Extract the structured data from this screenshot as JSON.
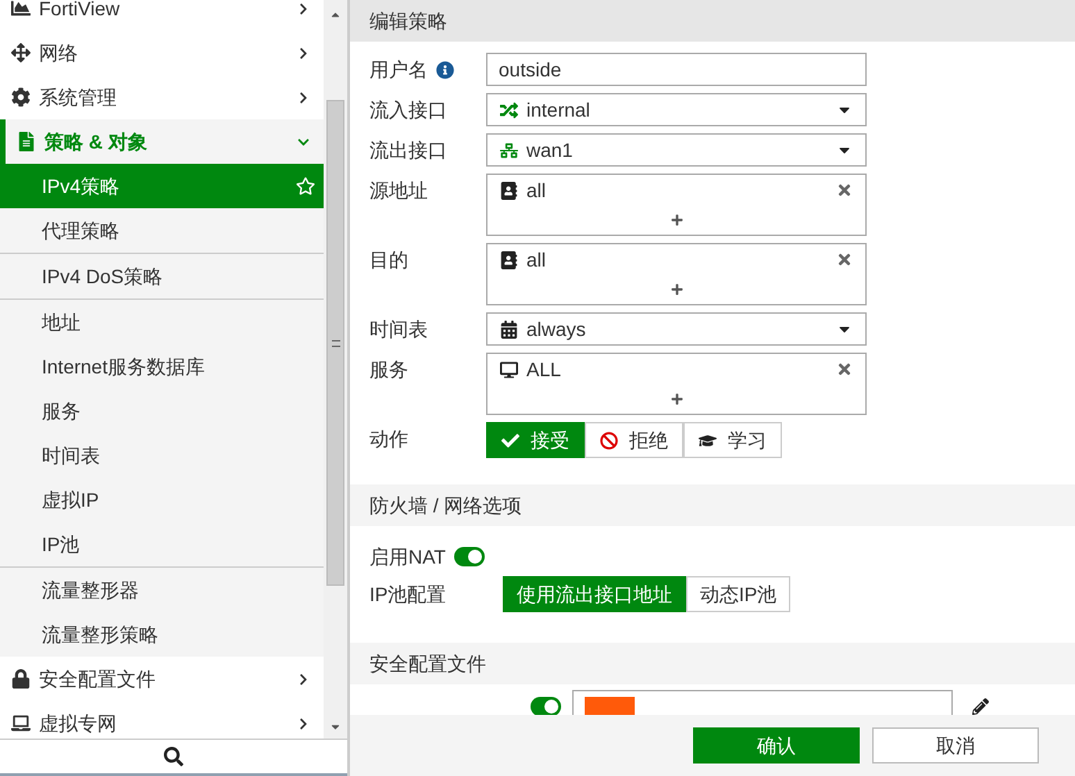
{
  "sidebar": {
    "items": [
      {
        "label": "FortiView",
        "expanded": false
      },
      {
        "label": "网络",
        "expanded": false
      },
      {
        "label": "系统管理",
        "expanded": false
      },
      {
        "label": "策略 & 对象",
        "expanded": true,
        "groups": [
          [
            {
              "label": "IPv4策略",
              "selected": true
            },
            {
              "label": "代理策略",
              "selected": false
            }
          ],
          [
            {
              "label": "IPv4 DoS策略",
              "selected": false
            }
          ],
          [
            {
              "label": "地址",
              "selected": false
            },
            {
              "label": "Internet服务数据库",
              "selected": false
            },
            {
              "label": "服务",
              "selected": false
            },
            {
              "label": "时间表",
              "selected": false
            },
            {
              "label": "虚拟IP",
              "selected": false
            },
            {
              "label": "IP池",
              "selected": false
            }
          ],
          [
            {
              "label": "流量整形器",
              "selected": false
            },
            {
              "label": "流量整形策略",
              "selected": false
            }
          ]
        ]
      },
      {
        "label": "安全配置文件",
        "expanded": false
      },
      {
        "label": "虚拟专网",
        "expanded": false
      }
    ]
  },
  "form": {
    "title": "编辑策略",
    "fields": [
      {
        "kind": "text",
        "label": "用户名",
        "info": true,
        "value": "outside"
      },
      {
        "kind": "select",
        "label": "流入接口",
        "value": "internal"
      },
      {
        "kind": "select",
        "label": "流出接口",
        "value": "wan1"
      },
      {
        "kind": "multi",
        "label": "源地址",
        "entries": [
          "all"
        ]
      },
      {
        "kind": "multi",
        "label": "目的",
        "entries": [
          "all"
        ]
      },
      {
        "kind": "select",
        "label": "时间表",
        "value": "always"
      },
      {
        "kind": "multi",
        "label": "服务",
        "entries": [
          "ALL"
        ]
      },
      {
        "kind": "choice",
        "label": "动作",
        "options": [
          {
            "label": "接受",
            "selected": true
          },
          {
            "label": "拒绝",
            "selected": false
          },
          {
            "label": "学习",
            "selected": false
          }
        ]
      }
    ]
  },
  "firewall": {
    "title": "防火墙 / 网络选项",
    "nat": {
      "label": "启用NAT",
      "on": true
    },
    "ip_pool": {
      "label": "IP池配置",
      "options": [
        {
          "label": "使用流出接口地址",
          "selected": true
        },
        {
          "label": "动态IP池",
          "selected": false
        }
      ]
    }
  },
  "security": {
    "title": "安全配置文件",
    "rows": [
      {
        "on": true
      }
    ]
  },
  "footer": {
    "buttons": [
      {
        "label": "确认",
        "kind": "primary"
      },
      {
        "label": "取消",
        "kind": "secondary"
      }
    ]
  }
}
